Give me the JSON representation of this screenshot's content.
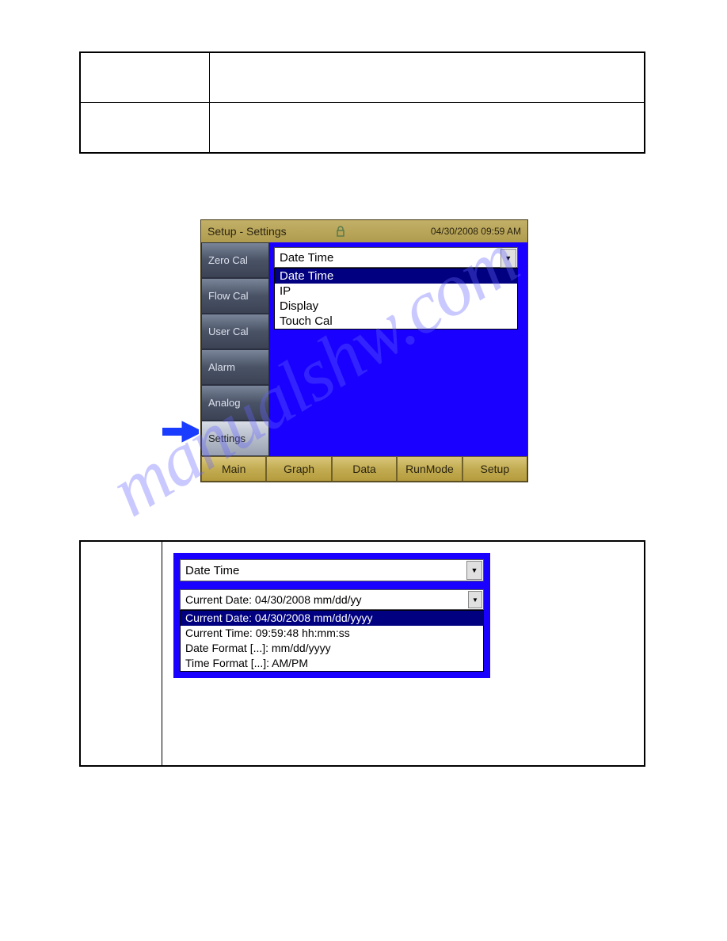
{
  "top_table": {
    "rows": 2,
    "cols": 2
  },
  "screen1": {
    "title": "Setup - Settings",
    "timestamp": "04/30/2008 09:59 AM",
    "side_tabs": [
      {
        "label": "Zero Cal",
        "selected": false
      },
      {
        "label": "Flow Cal",
        "selected": false
      },
      {
        "label": "User Cal",
        "selected": false
      },
      {
        "label": "Alarm",
        "selected": false
      },
      {
        "label": "Analog",
        "selected": false
      },
      {
        "label": "Settings",
        "selected": true
      }
    ],
    "dropdown_value": "Date Time",
    "dropdown_options": [
      {
        "label": "Date Time",
        "selected": true
      },
      {
        "label": "IP",
        "selected": false
      },
      {
        "label": "Display",
        "selected": false
      },
      {
        "label": "Touch Cal",
        "selected": false
      }
    ],
    "bottom_tabs": [
      "Main",
      "Graph",
      "Data",
      "RunMode",
      "Setup"
    ]
  },
  "screen2": {
    "dropdown_value": "Date Time",
    "current_field": "Current Date: 04/30/2008 mm/dd/yy",
    "options": [
      {
        "label": "Current Date: 04/30/2008 mm/dd/yyyy",
        "selected": true
      },
      {
        "label": "Current Time: 09:59:48 hh:mm:ss",
        "selected": false
      },
      {
        "label": "Date Format [...]: mm/dd/yyyy",
        "selected": false
      },
      {
        "label": "Time Format [...]: AM/PM",
        "selected": false
      }
    ]
  },
  "watermark": "manualshw.com"
}
